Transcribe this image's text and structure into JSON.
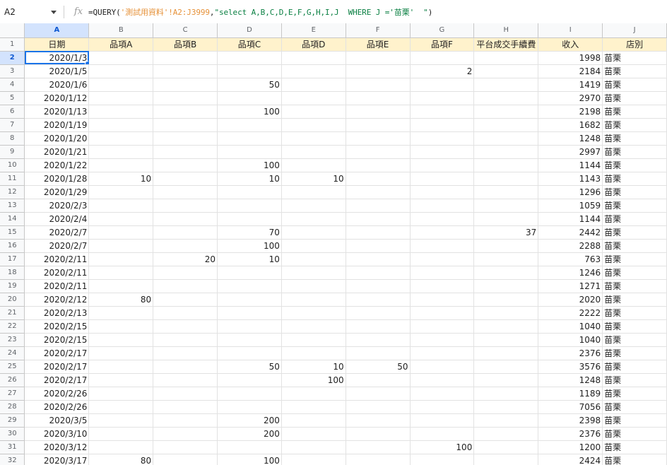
{
  "formula_bar": {
    "cell_ref": "A2",
    "fx_label": "fx",
    "formula_parts": [
      {
        "text": "=QUERY(",
        "style": "plain"
      },
      {
        "text": "'測試用資料'!A2:J3999",
        "style": "str1"
      },
      {
        "text": ",",
        "style": "plain"
      },
      {
        "text": "\"select A,B,C,D,E,F,G,H,I,J  WHERE J ='苗栗'  \"",
        "style": "str2"
      },
      {
        "text": ")",
        "style": "plain"
      }
    ]
  },
  "columns": [
    "A",
    "B",
    "C",
    "D",
    "E",
    "F",
    "G",
    "H",
    "I",
    "J"
  ],
  "selected_column": "A",
  "header_row": [
    "日期",
    "品項A",
    "品項B",
    "品項C",
    "品項D",
    "品項E",
    "品項F",
    "平台成交手續費",
    "收入",
    "店別"
  ],
  "rows": [
    {
      "n": "2",
      "cells": [
        "2020/1/3",
        "",
        "",
        "",
        "",
        "",
        "",
        "",
        "1998",
        "苗栗"
      ]
    },
    {
      "n": "3",
      "cells": [
        "2020/1/5",
        "",
        "",
        "",
        "",
        "",
        "2",
        "",
        "2184",
        "苗栗"
      ]
    },
    {
      "n": "4",
      "cells": [
        "2020/1/6",
        "",
        "",
        "50",
        "",
        "",
        "",
        "",
        "1419",
        "苗栗"
      ]
    },
    {
      "n": "5",
      "cells": [
        "2020/1/12",
        "",
        "",
        "",
        "",
        "",
        "",
        "",
        "2970",
        "苗栗"
      ]
    },
    {
      "n": "6",
      "cells": [
        "2020/1/13",
        "",
        "",
        "100",
        "",
        "",
        "",
        "",
        "2198",
        "苗栗"
      ]
    },
    {
      "n": "7",
      "cells": [
        "2020/1/19",
        "",
        "",
        "",
        "",
        "",
        "",
        "",
        "1682",
        "苗栗"
      ]
    },
    {
      "n": "8",
      "cells": [
        "2020/1/20",
        "",
        "",
        "",
        "",
        "",
        "",
        "",
        "1248",
        "苗栗"
      ]
    },
    {
      "n": "9",
      "cells": [
        "2020/1/21",
        "",
        "",
        "",
        "",
        "",
        "",
        "",
        "2997",
        "苗栗"
      ]
    },
    {
      "n": "10",
      "cells": [
        "2020/1/22",
        "",
        "",
        "100",
        "",
        "",
        "",
        "",
        "1144",
        "苗栗"
      ]
    },
    {
      "n": "11",
      "cells": [
        "2020/1/28",
        "10",
        "",
        "10",
        "10",
        "",
        "",
        "",
        "1143",
        "苗栗"
      ]
    },
    {
      "n": "12",
      "cells": [
        "2020/1/29",
        "",
        "",
        "",
        "",
        "",
        "",
        "",
        "1296",
        "苗栗"
      ]
    },
    {
      "n": "13",
      "cells": [
        "2020/2/3",
        "",
        "",
        "",
        "",
        "",
        "",
        "",
        "1059",
        "苗栗"
      ]
    },
    {
      "n": "14",
      "cells": [
        "2020/2/4",
        "",
        "",
        "",
        "",
        "",
        "",
        "",
        "1144",
        "苗栗"
      ]
    },
    {
      "n": "15",
      "cells": [
        "2020/2/7",
        "",
        "",
        "70",
        "",
        "",
        "",
        "37",
        "2442",
        "苗栗"
      ]
    },
    {
      "n": "16",
      "cells": [
        "2020/2/7",
        "",
        "",
        "100",
        "",
        "",
        "",
        "",
        "2288",
        "苗栗"
      ]
    },
    {
      "n": "17",
      "cells": [
        "2020/2/11",
        "",
        "20",
        "10",
        "",
        "",
        "",
        "",
        "763",
        "苗栗"
      ]
    },
    {
      "n": "18",
      "cells": [
        "2020/2/11",
        "",
        "",
        "",
        "",
        "",
        "",
        "",
        "1246",
        "苗栗"
      ]
    },
    {
      "n": "19",
      "cells": [
        "2020/2/11",
        "",
        "",
        "",
        "",
        "",
        "",
        "",
        "1271",
        "苗栗"
      ]
    },
    {
      "n": "20",
      "cells": [
        "2020/2/12",
        "80",
        "",
        "",
        "",
        "",
        "",
        "",
        "2020",
        "苗栗"
      ]
    },
    {
      "n": "21",
      "cells": [
        "2020/2/13",
        "",
        "",
        "",
        "",
        "",
        "",
        "",
        "2222",
        "苗栗"
      ]
    },
    {
      "n": "22",
      "cells": [
        "2020/2/15",
        "",
        "",
        "",
        "",
        "",
        "",
        "",
        "1040",
        "苗栗"
      ]
    },
    {
      "n": "23",
      "cells": [
        "2020/2/15",
        "",
        "",
        "",
        "",
        "",
        "",
        "",
        "1040",
        "苗栗"
      ]
    },
    {
      "n": "24",
      "cells": [
        "2020/2/17",
        "",
        "",
        "",
        "",
        "",
        "",
        "",
        "2376",
        "苗栗"
      ]
    },
    {
      "n": "25",
      "cells": [
        "2020/2/17",
        "",
        "",
        "50",
        "10",
        "50",
        "",
        "",
        "3576",
        "苗栗"
      ]
    },
    {
      "n": "26",
      "cells": [
        "2020/2/17",
        "",
        "",
        "",
        "100",
        "",
        "",
        "",
        "1248",
        "苗栗"
      ]
    },
    {
      "n": "27",
      "cells": [
        "2020/2/26",
        "",
        "",
        "",
        "",
        "",
        "",
        "",
        "1189",
        "苗栗"
      ]
    },
    {
      "n": "28",
      "cells": [
        "2020/2/26",
        "",
        "",
        "",
        "",
        "",
        "",
        "",
        "7056",
        "苗栗"
      ]
    },
    {
      "n": "29",
      "cells": [
        "2020/3/5",
        "",
        "",
        "200",
        "",
        "",
        "",
        "",
        "2398",
        "苗栗"
      ]
    },
    {
      "n": "30",
      "cells": [
        "2020/3/10",
        "",
        "",
        "200",
        "",
        "",
        "",
        "",
        "2376",
        "苗栗"
      ]
    },
    {
      "n": "31",
      "cells": [
        "2020/3/12",
        "",
        "",
        "",
        "",
        "",
        "100",
        "",
        "1200",
        "苗栗"
      ]
    },
    {
      "n": "32",
      "cells": [
        "2020/3/17",
        "80",
        "",
        "100",
        "",
        "",
        "",
        "",
        "2424",
        "苗栗"
      ]
    }
  ],
  "colors": {
    "header_fill": "#fff2cc",
    "selection": "#1a73e8",
    "formula_range": "#e69138",
    "formula_string": "#0b8043"
  }
}
